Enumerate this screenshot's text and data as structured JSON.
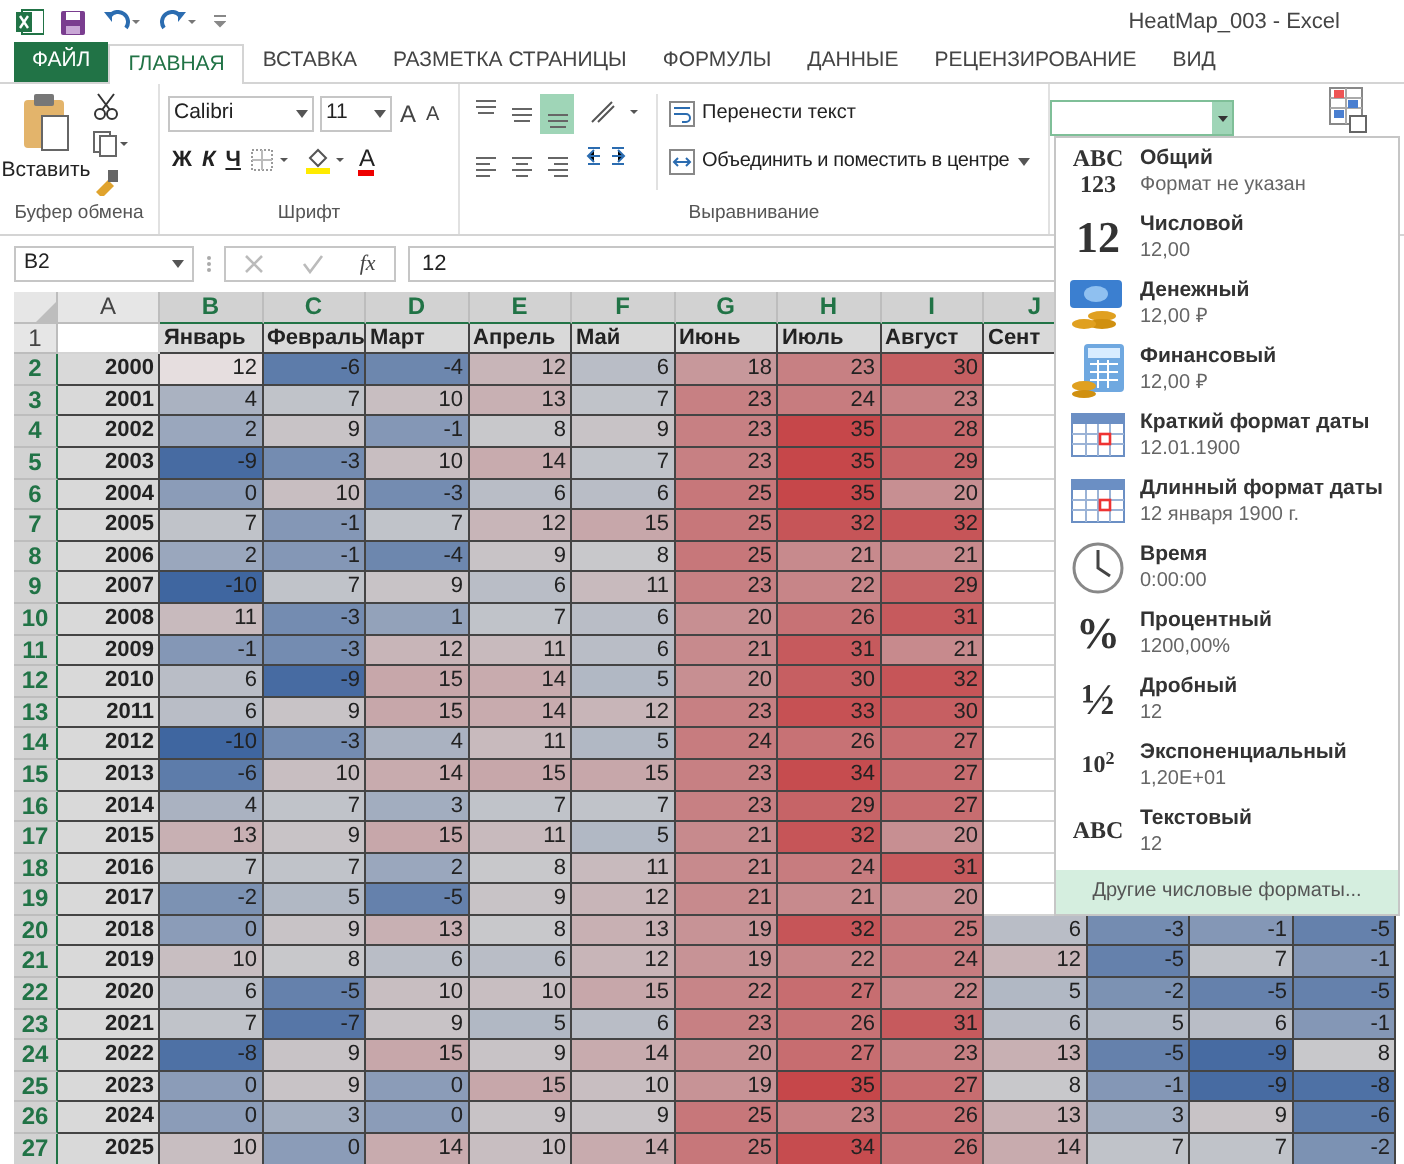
{
  "title_bar": {
    "title": "HeatMap_003 - Excel"
  },
  "ribbon_tabs": [
    {
      "label": "ФАЙЛ",
      "kind": "file",
      "selected": false
    },
    {
      "label": "ГЛАВНАЯ",
      "kind": "tab",
      "selected": true
    },
    {
      "label": "ВСТАВКА",
      "kind": "tab",
      "selected": false
    },
    {
      "label": "РАЗМЕТКА СТРАНИЦЫ",
      "kind": "tab",
      "selected": false
    },
    {
      "label": "ФОРМУЛЫ",
      "kind": "tab",
      "selected": false
    },
    {
      "label": "ДАННЫЕ",
      "kind": "tab",
      "selected": false
    },
    {
      "label": "РЕЦЕНЗИРОВАНИЕ",
      "kind": "tab",
      "selected": false
    },
    {
      "label": "ВИД",
      "kind": "tab",
      "selected": false
    }
  ],
  "clipboard": {
    "paste_label": "Вставить",
    "group_label": "Буфер обмена"
  },
  "font": {
    "name": "Calibri",
    "size": "11",
    "grow": "A",
    "shrink": "A",
    "bold": "Ж",
    "italic": "К",
    "underline": "Ч",
    "font_color": "A",
    "group_label": "Шрифт"
  },
  "alignment": {
    "valign_buttons": [
      {
        "selected": false
      },
      {
        "selected": false
      },
      {
        "selected": true
      }
    ],
    "wrap_text": "Перенести текст",
    "merge": "Объединить и поместить в центре",
    "group_label": "Выравнивание"
  },
  "formula_bar": {
    "name_box": "B2",
    "fx": "fx",
    "value": "12"
  },
  "sheet": {
    "columns": [
      {
        "letter": "A",
        "selected": false
      },
      {
        "letter": "B",
        "selected": true
      },
      {
        "letter": "C",
        "selected": true
      },
      {
        "letter": "D",
        "selected": true
      },
      {
        "letter": "E",
        "selected": true
      },
      {
        "letter": "F",
        "selected": true
      },
      {
        "letter": "G",
        "selected": true
      },
      {
        "letter": "H",
        "selected": true
      },
      {
        "letter": "I",
        "selected": true
      },
      {
        "letter": "J",
        "selected": true
      }
    ],
    "header_row": {
      "number": "1",
      "selected": false,
      "labels": [
        "Январь",
        "Февраль",
        "Март",
        "Апрель",
        "Май",
        "Июнь",
        "Июль",
        "Август",
        "Сент"
      ]
    },
    "rows": [
      {
        "number": "2",
        "selected": true,
        "year": "2000",
        "values": [
          "12",
          "-6",
          "-4",
          "12",
          "6",
          "18",
          "23",
          "30"
        ]
      },
      {
        "number": "3",
        "selected": true,
        "year": "2001",
        "values": [
          "4",
          "7",
          "10",
          "13",
          "7",
          "23",
          "24",
          "23"
        ]
      },
      {
        "number": "4",
        "selected": true,
        "year": "2002",
        "values": [
          "2",
          "9",
          "-1",
          "8",
          "9",
          "23",
          "35",
          "28"
        ]
      },
      {
        "number": "5",
        "selected": true,
        "year": "2003",
        "values": [
          "-9",
          "-3",
          "10",
          "14",
          "7",
          "23",
          "35",
          "29"
        ]
      },
      {
        "number": "6",
        "selected": true,
        "year": "2004",
        "values": [
          "0",
          "10",
          "-3",
          "6",
          "6",
          "25",
          "35",
          "20"
        ]
      },
      {
        "number": "7",
        "selected": true,
        "year": "2005",
        "values": [
          "7",
          "-1",
          "7",
          "12",
          "15",
          "25",
          "32",
          "32"
        ]
      },
      {
        "number": "8",
        "selected": true,
        "year": "2006",
        "values": [
          "2",
          "-1",
          "-4",
          "9",
          "8",
          "25",
          "21",
          "21"
        ]
      },
      {
        "number": "9",
        "selected": true,
        "year": "2007",
        "values": [
          "-10",
          "7",
          "9",
          "6",
          "11",
          "23",
          "22",
          "29"
        ]
      },
      {
        "number": "10",
        "selected": true,
        "year": "2008",
        "values": [
          "11",
          "-3",
          "1",
          "7",
          "6",
          "20",
          "26",
          "31"
        ]
      },
      {
        "number": "11",
        "selected": true,
        "year": "2009",
        "values": [
          "-1",
          "-3",
          "12",
          "11",
          "6",
          "21",
          "31",
          "21"
        ]
      },
      {
        "number": "12",
        "selected": true,
        "year": "2010",
        "values": [
          "6",
          "-9",
          "15",
          "14",
          "5",
          "20",
          "30",
          "32"
        ]
      },
      {
        "number": "13",
        "selected": true,
        "year": "2011",
        "values": [
          "6",
          "9",
          "15",
          "14",
          "12",
          "23",
          "33",
          "30"
        ]
      },
      {
        "number": "14",
        "selected": true,
        "year": "2012",
        "values": [
          "-10",
          "-3",
          "4",
          "11",
          "5",
          "24",
          "26",
          "27"
        ]
      },
      {
        "number": "15",
        "selected": true,
        "year": "2013",
        "values": [
          "-6",
          "10",
          "14",
          "15",
          "15",
          "23",
          "34",
          "27"
        ]
      },
      {
        "number": "16",
        "selected": true,
        "year": "2014",
        "values": [
          "4",
          "7",
          "3",
          "7",
          "7",
          "23",
          "29",
          "27"
        ]
      },
      {
        "number": "17",
        "selected": true,
        "year": "2015",
        "values": [
          "13",
          "9",
          "15",
          "11",
          "5",
          "21",
          "32",
          "20"
        ]
      },
      {
        "number": "18",
        "selected": true,
        "year": "2016",
        "values": [
          "7",
          "7",
          "2",
          "8",
          "11",
          "21",
          "24",
          "31"
        ]
      },
      {
        "number": "19",
        "selected": true,
        "year": "2017",
        "values": [
          "-2",
          "5",
          "-5",
          "9",
          "12",
          "21",
          "21",
          "20"
        ]
      },
      {
        "number": "20",
        "selected": true,
        "year": "2018",
        "values": [
          "0",
          "9",
          "13",
          "8",
          "13",
          "19",
          "32",
          "25",
          "6",
          "-3",
          "-1",
          "-5"
        ]
      },
      {
        "number": "21",
        "selected": true,
        "year": "2019",
        "values": [
          "10",
          "8",
          "6",
          "6",
          "12",
          "19",
          "22",
          "24",
          "12",
          "-5",
          "7",
          "-1"
        ]
      },
      {
        "number": "22",
        "selected": true,
        "year": "2020",
        "values": [
          "6",
          "-5",
          "10",
          "10",
          "15",
          "22",
          "27",
          "22",
          "5",
          "-2",
          "-5",
          "-5"
        ]
      },
      {
        "number": "23",
        "selected": true,
        "year": "2021",
        "values": [
          "7",
          "-7",
          "9",
          "5",
          "6",
          "23",
          "26",
          "31",
          "6",
          "5",
          "6",
          "-1"
        ]
      },
      {
        "number": "24",
        "selected": true,
        "year": "2022",
        "values": [
          "-8",
          "9",
          "15",
          "9",
          "14",
          "20",
          "27",
          "23",
          "13",
          "-5",
          "-9",
          "8"
        ]
      },
      {
        "number": "25",
        "selected": true,
        "year": "2023",
        "values": [
          "0",
          "9",
          "0",
          "15",
          "10",
          "19",
          "35",
          "27",
          "8",
          "-1",
          "-9",
          "-8"
        ]
      },
      {
        "number": "26",
        "selected": true,
        "year": "2024",
        "values": [
          "0",
          "3",
          "0",
          "9",
          "9",
          "25",
          "23",
          "26",
          "13",
          "3",
          "9",
          "-6"
        ]
      },
      {
        "number": "27",
        "selected": true,
        "year": "2025",
        "values": [
          "10",
          "0",
          "14",
          "10",
          "14",
          "25",
          "34",
          "26",
          "14",
          "7",
          "7",
          "-2"
        ]
      }
    ]
  },
  "format_menu": {
    "items": [
      {
        "kind": "glyph",
        "glyph_lines": [
          "ABC",
          "123"
        ],
        "title": "Общий",
        "example": "Формат не указан"
      },
      {
        "kind": "glyph",
        "glyph_lines": [
          "12"
        ],
        "title": "Числовой",
        "example": "12,00"
      },
      {
        "kind": "money",
        "title": "Денежный",
        "example": "12,00 ₽"
      },
      {
        "kind": "accounting",
        "title": "Финансовый",
        "example": "12,00 ₽"
      },
      {
        "kind": "calendar",
        "title": "Краткий формат даты",
        "example": "12.01.1900"
      },
      {
        "kind": "calendar",
        "title": "Длинный формат даты",
        "example": "12 января 1900 г."
      },
      {
        "kind": "clock",
        "title": "Время",
        "example": "0:00:00"
      },
      {
        "kind": "glyph",
        "glyph_lines": [
          "%"
        ],
        "title": "Процентный",
        "example": "1200,00%"
      },
      {
        "kind": "glyph",
        "glyph_lines": [
          "½"
        ],
        "title": "Дробный",
        "example": "12"
      },
      {
        "kind": "glyph",
        "glyph_lines": [
          "10$^{2}$"
        ],
        "title": "Экспоненциальный",
        "example": "1,20E+01"
      },
      {
        "kind": "glyph",
        "glyph_lines": [
          "ABC"
        ],
        "title": "Текстовый",
        "example": "12"
      }
    ],
    "footer": {
      "label": "Другие числовые форматы...",
      "hovered": true
    }
  }
}
